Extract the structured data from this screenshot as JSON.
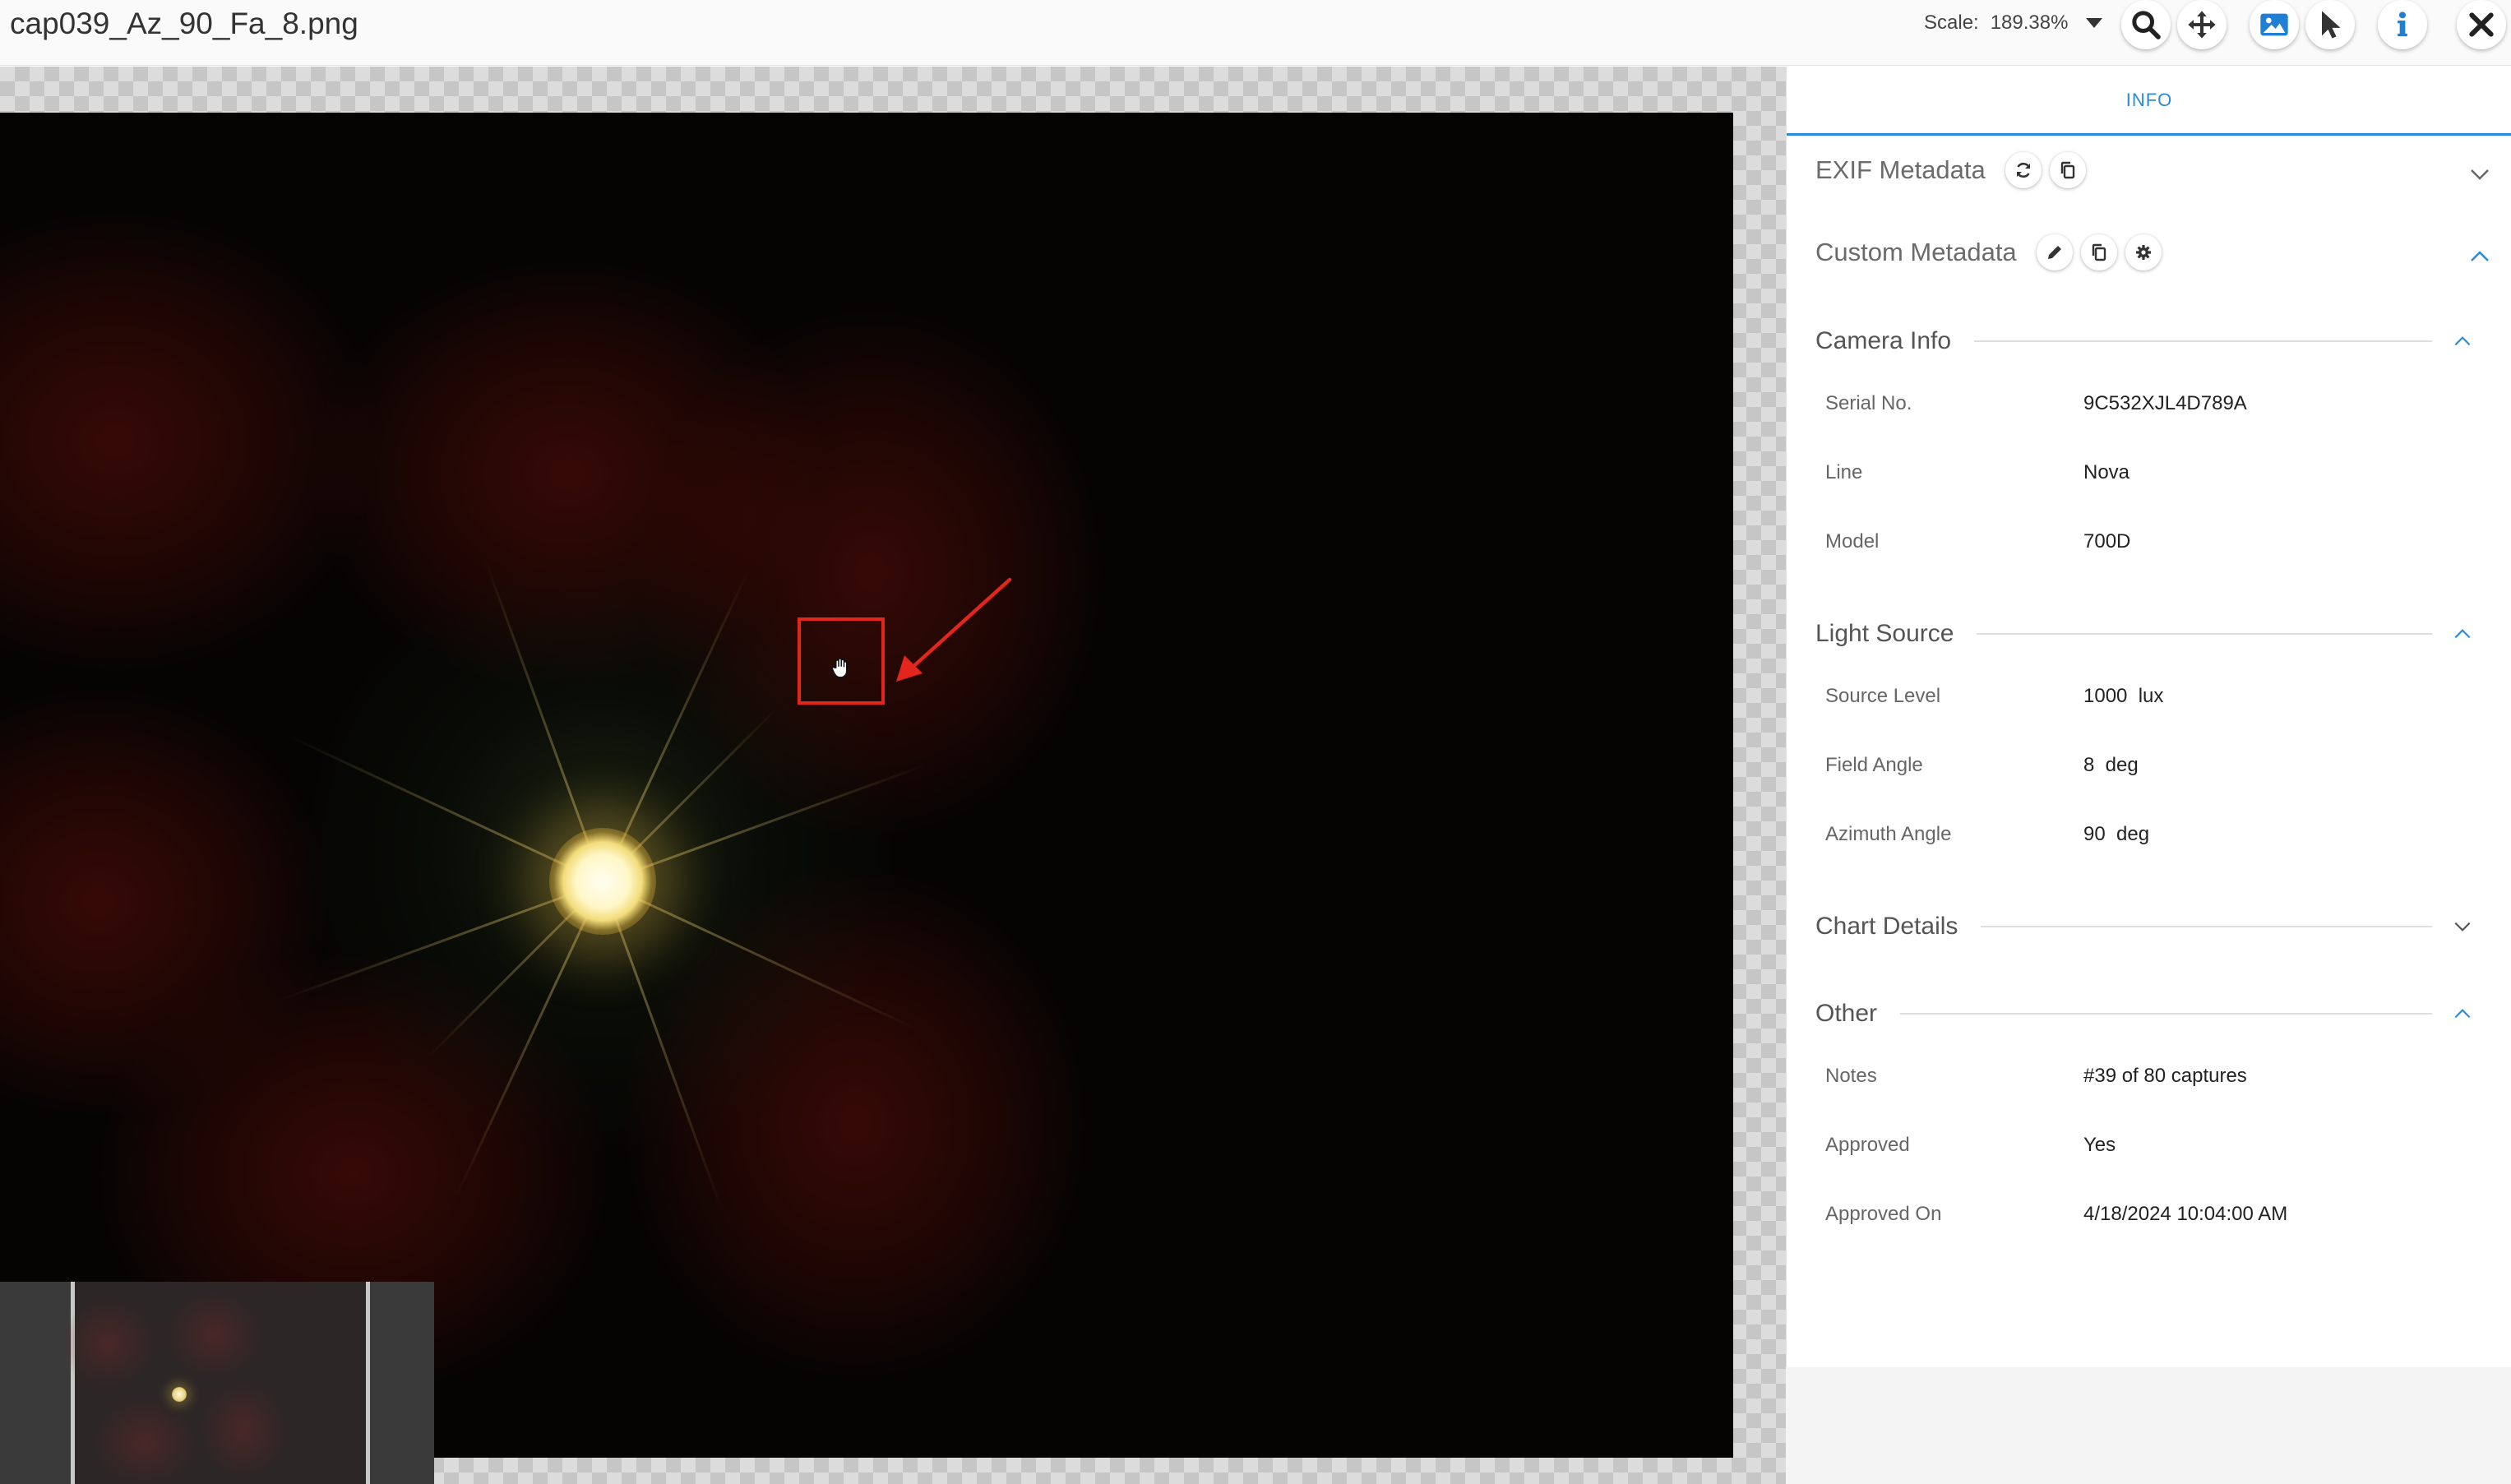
{
  "window": {
    "file_name": "cap039_Az_90_Fa_8.png",
    "scale_label": "Scale:",
    "scale_value": "189.38%"
  },
  "toolbar": {
    "icons": [
      "search-icon",
      "move-icon",
      "image-icon",
      "pointer-icon",
      "info-icon",
      "close-icon"
    ]
  },
  "panel": {
    "tab": "INFO",
    "exif_title": "EXIF Metadata",
    "custom_title": "Custom Metadata",
    "sections": {
      "camera": {
        "title": "Camera Info",
        "rows": [
          {
            "k": "Serial No.",
            "v": "9C532XJL4D789A"
          },
          {
            "k": "Line",
            "v": "Nova"
          },
          {
            "k": "Model",
            "v": "700D"
          }
        ]
      },
      "light": {
        "title": "Light Source",
        "rows": [
          {
            "k": "Source Level",
            "v": "1000  lux"
          },
          {
            "k": "Field Angle",
            "v": "8  deg"
          },
          {
            "k": "Azimuth Angle",
            "v": "90  deg"
          }
        ]
      },
      "chart": {
        "title": "Chart Details"
      },
      "other": {
        "title": "Other",
        "rows": [
          {
            "k": "Notes",
            "v": "#39 of 80 captures"
          },
          {
            "k": "Approved",
            "v": "Yes"
          },
          {
            "k": "Approved On",
            "v": "4/18/2024 10:04:00 AM"
          }
        ]
      }
    }
  },
  "colors": {
    "accent": "#2a8bd6",
    "annotation": "#e3261c"
  }
}
